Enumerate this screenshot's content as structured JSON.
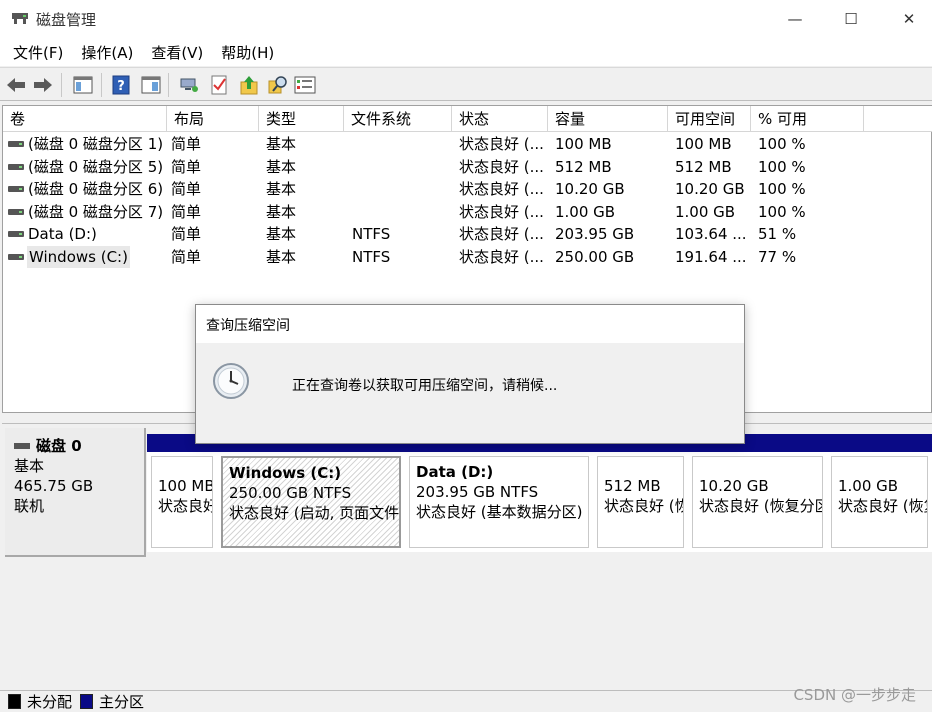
{
  "window": {
    "title": "磁盘管理",
    "minimize": "—",
    "maximize": "☐",
    "close": "✕"
  },
  "menu": [
    "文件(F)",
    "操作(A)",
    "查看(V)",
    "帮助(H)"
  ],
  "toolbar_icons": [
    "back-arrow-icon",
    "forward-arrow-icon",
    "console-tree-icon",
    "help-icon",
    "pane-icon",
    "connect-icon",
    "properties-check-icon",
    "up-folder-icon",
    "search-icon",
    "list-icon"
  ],
  "columns": [
    "卷",
    "布局",
    "类型",
    "文件系统",
    "状态",
    "容量",
    "可用空间",
    "% 可用"
  ],
  "volumes": [
    {
      "name": "(磁盘 0 磁盘分区 1)",
      "layout": "简单",
      "type": "基本",
      "fs": "",
      "status": "状态良好 (...",
      "capacity": "100 MB",
      "free": "100 MB",
      "pct": "100 %"
    },
    {
      "name": "(磁盘 0 磁盘分区 5)",
      "layout": "简单",
      "type": "基本",
      "fs": "",
      "status": "状态良好 (...",
      "capacity": "512 MB",
      "free": "512 MB",
      "pct": "100 %"
    },
    {
      "name": "(磁盘 0 磁盘分区 6)",
      "layout": "简单",
      "type": "基本",
      "fs": "",
      "status": "状态良好 (...",
      "capacity": "10.20 GB",
      "free": "10.20 GB",
      "pct": "100 %"
    },
    {
      "name": "(磁盘 0 磁盘分区 7)",
      "layout": "简单",
      "type": "基本",
      "fs": "",
      "status": "状态良好 (...",
      "capacity": "1.00 GB",
      "free": "1.00 GB",
      "pct": "100 %"
    },
    {
      "name": "Data (D:)",
      "layout": "简单",
      "type": "基本",
      "fs": "NTFS",
      "status": "状态良好 (...",
      "capacity": "203.95 GB",
      "free": "103.64 ...",
      "pct": "51 %"
    },
    {
      "name": "Windows (C:)",
      "layout": "简单",
      "type": "基本",
      "fs": "NTFS",
      "status": "状态良好 (...",
      "capacity": "250.00 GB",
      "free": "191.64 ...",
      "pct": "77 %"
    }
  ],
  "disk": {
    "name": "磁盘 0",
    "kind": "基本",
    "size": "465.75 GB",
    "state": "联机"
  },
  "partitions": [
    {
      "name": "",
      "size": "100 MB",
      "status": "状态良好"
    },
    {
      "name": "Windows  (C:)",
      "size": "250.00 GB NTFS",
      "status": "状态良好 (启动, 页面文件,"
    },
    {
      "name": "Data  (D:)",
      "size": "203.95 GB NTFS",
      "status": "状态良好 (基本数据分区)"
    },
    {
      "name": "",
      "size": "512 MB",
      "status": "状态良好 (恢"
    },
    {
      "name": "",
      "size": "10.20 GB",
      "status": "状态良好 (恢复分区"
    },
    {
      "name": "",
      "size": "1.00 GB",
      "status": "状态良好 (恢复"
    }
  ],
  "legend": {
    "unallocated": "未分配",
    "primary": "主分区",
    "unallocated_color": "#000000",
    "primary_color": "#0a0a86"
  },
  "dialog": {
    "title": "查询压缩空间",
    "message": "正在查询卷以获取可用压缩空间，请稍候..."
  },
  "watermark": "CSDN @一步步走"
}
